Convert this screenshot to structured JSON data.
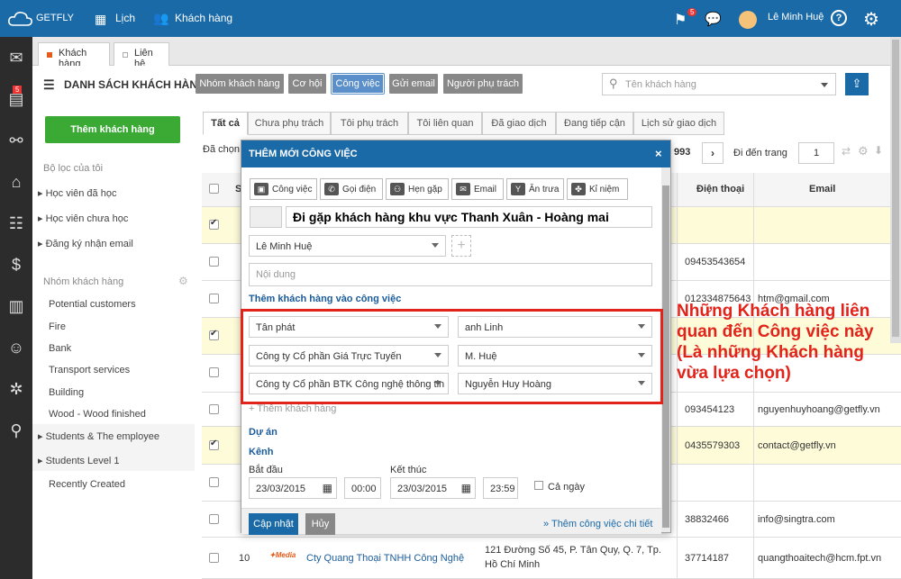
{
  "topbar": {
    "logo": "GETFLY",
    "nav": [
      {
        "label": "Lịch",
        "icon": "calendar-icon"
      },
      {
        "label": "Khách hàng",
        "icon": "users-icon"
      }
    ],
    "notify_count": "5",
    "user_name": "Lê Minh Huệ"
  },
  "leftrail": {
    "badge": "5"
  },
  "page_tabs": [
    "Khách hàng",
    "Liên hệ"
  ],
  "header": {
    "title": "DANH SÁCH KHÁCH HÀNG",
    "buttons": [
      "Nhóm khách hàng",
      "Cơ hội",
      "Công việc",
      "Gửi email",
      "Người phụ trách"
    ],
    "search_placeholder": "Tên khách hàng"
  },
  "sidebar": {
    "add_button": "Thêm khách hàng",
    "filter_title": "Bộ lọc của tôi",
    "filters": [
      "Học viên đã học",
      "Học viên chưa học",
      "Đăng ký nhận email"
    ],
    "group_title": "Nhóm khách hàng",
    "groups": [
      "Potential customers",
      "Fire",
      "Bank",
      "Transport services",
      "Building",
      "Wood - Wood finished",
      "Students & The employee",
      "Students Level 1",
      "Recently Created"
    ]
  },
  "filter_tabs": [
    "Tất cả",
    "Chưa phụ trách",
    "Tôi phụ trách",
    "Tôi liên quan",
    "Đã giao dịch",
    "Đang tiếp cận",
    "Lịch sử giao dịch"
  ],
  "selection": {
    "selected_prefix": "Đã chọn",
    "total_fragment": "993",
    "goto_label": "Đi đến trang",
    "page": "1"
  },
  "table": {
    "headers": {
      "stt": "S",
      "phone": "Điện thoại",
      "email": "Email"
    },
    "rows": [
      {
        "checked": true,
        "phone": "",
        "email": ""
      },
      {
        "checked": false,
        "phone": "09453543654",
        "email": ""
      },
      {
        "checked": false,
        "phone": "012334875643",
        "email": "htm@gmail.com"
      },
      {
        "checked": true,
        "phone": "",
        "email": ""
      },
      {
        "checked": false,
        "phone": "",
        "email": ""
      },
      {
        "checked": false,
        "phone": "093454123",
        "email": "nguyenhuyhoang@getfly.vn"
      },
      {
        "checked": true,
        "phone": "0435579303",
        "email": "contact@getfly.vn"
      },
      {
        "checked": false,
        "phone": "",
        "email": ""
      },
      {
        "checked": false,
        "phone": "38832466",
        "email": "info@singtra.com"
      },
      {
        "checked": false,
        "stt": "10",
        "name": "Cty Quang Thoại TNHH Công Nghệ",
        "address": "121 Đường Số 45, P. Tân Quy, Q. 7, Tp. Hồ Chí Minh",
        "phone": "37714187",
        "email": "quangthoaitech@hcm.fpt.vn"
      }
    ]
  },
  "modal": {
    "title": "THÊM MỚI CÔNG VIỆC",
    "types": [
      {
        "label": "Công việc",
        "icon": "briefcase-icon"
      },
      {
        "label": "Gọi điện",
        "icon": "phone-icon"
      },
      {
        "label": "Hẹn gặp",
        "icon": "handshake-icon"
      },
      {
        "label": "Email",
        "icon": "envelope-icon"
      },
      {
        "label": "Ăn trưa",
        "icon": "cocktail-icon"
      },
      {
        "label": "Kỉ niệm",
        "icon": "gift-icon"
      }
    ],
    "task_name": "Đi gặp khách hàng khu vực Thanh Xuân - Hoàng mai",
    "assignee": "Lê Minh Huệ",
    "content_placeholder": "Nội dung",
    "add_customers_title": "Thêm khách hàng vào công việc",
    "customers": [
      {
        "company": "Tân phát",
        "contact": "anh Linh"
      },
      {
        "company": "Công ty Cổ phần Giá Trực Tuyến",
        "contact": "M. Huệ"
      },
      {
        "company": "Công ty Cổ phần BTK Công nghệ thông tin",
        "contact": "Nguyễn Huy Hoàng"
      }
    ],
    "add_customer_link": "Thêm khách hàng",
    "project_label": "Dự án",
    "channel_label": "Kênh",
    "start_label": "Bắt đầu",
    "start_date": "23/03/2015",
    "start_time": "00:00",
    "end_label": "Kết thúc",
    "end_date": "23/03/2015",
    "end_time": "23:59",
    "all_day": "Cả ngày",
    "save": "Cập nhật",
    "cancel": "Hủy",
    "more_link": "» Thêm công việc chi tiết"
  },
  "annotation": "Những Khách hàng liên quan đến Công việc này (Là những Khách hàng vừa lựa chọn)",
  "colors": {
    "brand_blue": "#1a6aa8",
    "green": "#3aaa35",
    "red": "#e2231a",
    "highlight_row": "#fdfbd8"
  }
}
